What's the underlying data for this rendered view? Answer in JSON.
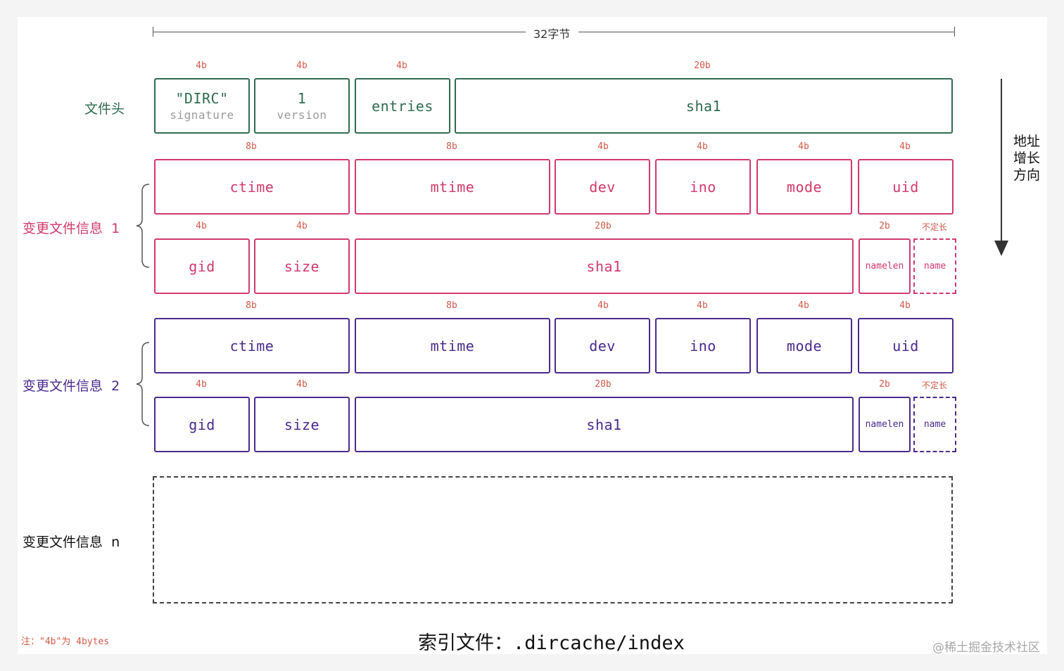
{
  "ruler": {
    "label": "32字节"
  },
  "header": {
    "label": "文件头",
    "fields": [
      {
        "size": "4b",
        "text": "\"DIRC\"",
        "sub": "signature"
      },
      {
        "size": "4b",
        "text": "1",
        "sub": "version"
      },
      {
        "size": "4b",
        "text": "entries"
      },
      {
        "size": "20b",
        "text": "sha1"
      }
    ]
  },
  "entry1": {
    "label": "变更文件信息  1",
    "row1": [
      {
        "size": "8b",
        "text": "ctime"
      },
      {
        "size": "8b",
        "text": "mtime"
      },
      {
        "size": "4b",
        "text": "dev"
      },
      {
        "size": "4b",
        "text": "ino"
      },
      {
        "size": "4b",
        "text": "mode"
      },
      {
        "size": "4b",
        "text": "uid"
      }
    ],
    "row2": [
      {
        "size": "4b",
        "text": "gid"
      },
      {
        "size": "4b",
        "text": "size"
      },
      {
        "size": "20b",
        "text": "sha1"
      },
      {
        "size": "2b",
        "text": "namelen"
      },
      {
        "size": "不定长",
        "text": "name"
      }
    ]
  },
  "entry2": {
    "label": "变更文件信息  2",
    "row1": [
      {
        "size": "8b",
        "text": "ctime"
      },
      {
        "size": "8b",
        "text": "mtime"
      },
      {
        "size": "4b",
        "text": "dev"
      },
      {
        "size": "4b",
        "text": "ino"
      },
      {
        "size": "4b",
        "text": "mode"
      },
      {
        "size": "4b",
        "text": "uid"
      }
    ],
    "row2": [
      {
        "size": "4b",
        "text": "gid"
      },
      {
        "size": "4b",
        "text": "size"
      },
      {
        "size": "20b",
        "text": "sha1"
      },
      {
        "size": "2b",
        "text": "namelen"
      },
      {
        "size": "不定长",
        "text": "name"
      }
    ]
  },
  "entryN": {
    "label": "变更文件信息  n"
  },
  "direction": {
    "label_line1": "地址",
    "label_line2": "增长",
    "label_line3": "方向"
  },
  "footnote": "注：\"4b\"为 4bytes",
  "caption": "索引文件：.dircache/index",
  "watermark": "@稀土掘金技术社区",
  "colors": {
    "header": "#2f6b4f",
    "entry1": "#d03a6a",
    "entry2": "#4a2a8e",
    "size_label": "#d25a4a"
  }
}
